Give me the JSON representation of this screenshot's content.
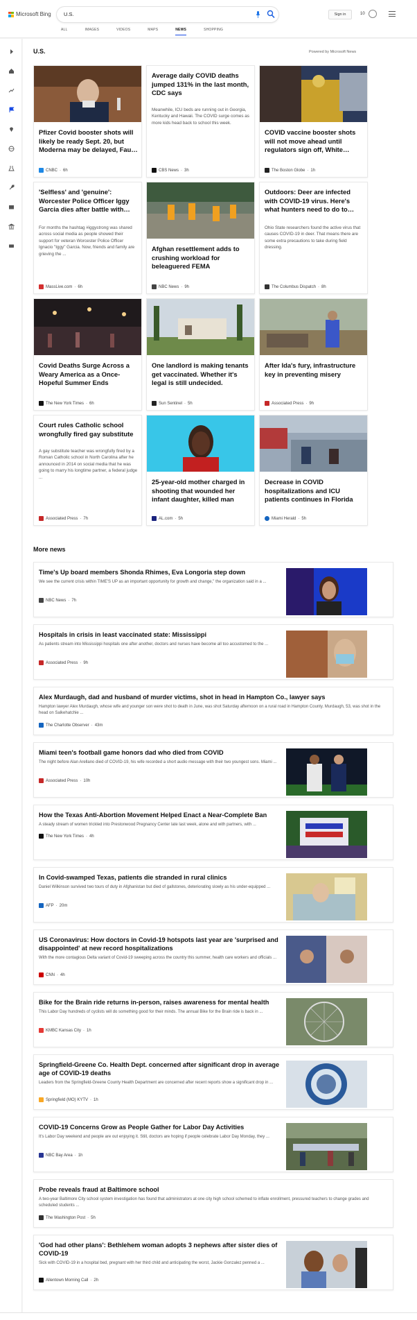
{
  "header": {
    "logo_text": "Microsoft Bing",
    "search_value": "U.S.",
    "signin_label": "Sign in",
    "points": "10",
    "tabs": [
      {
        "label": "ALL"
      },
      {
        "label": "IMAGES"
      },
      {
        "label": "VIDEOS"
      },
      {
        "label": "MAPS"
      },
      {
        "label": "NEWS",
        "active": true
      },
      {
        "label": "SHOPPING"
      }
    ]
  },
  "rail_icons": [
    "expand-icon",
    "home-icon",
    "trending-icon",
    "flag-icon",
    "location-icon",
    "world-icon",
    "science-icon",
    "rocket-icon",
    "entertainment-icon",
    "politics-icon",
    "money-icon"
  ],
  "main": {
    "section_title": "U.S.",
    "powered_by": "Powered by Microsoft News",
    "more_title": "More news"
  },
  "cards": [
    {
      "title": "Pfizer Covid booster shots will likely be ready Sept. 20, but Moderna may be delayed, Fau…",
      "snippet": "",
      "source": "CNBC",
      "time": "6h",
      "logo_color": "#1e88e5"
    },
    {
      "title": "Average daily COVID deaths jumped 131% in the last month, CDC says",
      "snippet": "Meanwhile, ICU beds are running out in Georgia, Kentucky and Hawaii. The COVID surge comes as more kids head back to school this week.",
      "source": "CBS News",
      "time": "3h",
      "logo_color": "#111111"
    },
    {
      "title": "COVID vaccine booster shots will not move ahead until regulators sign off, White…",
      "snippet": "",
      "source": "The Boston Globe",
      "time": "1h",
      "logo_color": "#222222"
    },
    {
      "title": "'Selfless' and 'genuine': Worcester Police Officer Iggy Garcia dies after battle with…",
      "snippet": "For months the hashtag #iggystrong was shared across social media as people showed their support for veteran Worcester Police Officer Ignacio \"Iggy\" Garcia. Now, friends and family are grieving the ...",
      "source": "MassLive.com",
      "time": "6h",
      "logo_color": "#d32f2f"
    },
    {
      "title": "Afghan resettlement adds to crushing workload for beleaguered FEMA",
      "snippet": "",
      "source": "NBC News",
      "time": "9h",
      "logo_color": "#444444"
    },
    {
      "title": "Outdoors: Deer are infected with COVID-19 virus. Here's what hunters need to do to…",
      "snippet": "Ohio State researchers found the active virus that causes COVID-19 in deer. That means there are some extra precautions to take during field dressing.",
      "source": "The Columbus Dispatch",
      "time": "8h",
      "logo_color": "#333333"
    },
    {
      "title": "Covid Deaths Surge Across a Weary America as a Once-Hopeful Summer Ends",
      "snippet": "",
      "source": "The New York Times",
      "time": "6h",
      "logo_color": "#111111"
    },
    {
      "title": "One landlord is making tenants get vaccinated. Whether it's legal is still undecided.",
      "snippet": "",
      "source": "Sun Sentinel",
      "time": "5h",
      "logo_color": "#222222"
    },
    {
      "title": "After Ida's fury, infrastructure key in preventing misery",
      "snippet": "",
      "source": "Associated Press",
      "time": "9h",
      "logo_color": "#c62828"
    },
    {
      "title": "Court rules Catholic school wrongfully fired gay substitute",
      "snippet": "A gay substitute teacher was wrongfully fired by a Roman Catholic school in North Carolina after he announced in 2014 on social media that he was going to marry his longtime partner, a federal judge ...",
      "source": "Associated Press",
      "time": "7h",
      "logo_color": "#c62828"
    },
    {
      "title": "25-year-old mother charged in shooting that wounded her infant daughter, killed man",
      "snippet": "",
      "source": "AL.com",
      "time": "5h",
      "logo_color": "#1a237e"
    },
    {
      "title": "Decrease in COVID hospitalizations and ICU patients continues in Florida",
      "snippet": "",
      "source": "Miami Herald",
      "time": "5h",
      "logo_color": "#1565c0"
    }
  ],
  "more_news": [
    {
      "title": "Time's Up board members Shonda Rhimes, Eva Longoria step down",
      "snippet": "We see the current crisis within TIME'S UP as an important opportunity for growth and change,\" the organization said in a ...",
      "source": "NBC News",
      "time": "7h",
      "logo_color": "#444444"
    },
    {
      "title": "Hospitals in crisis in least vaccinated state: Mississippi",
      "snippet": "As patients stream into Mississippi hospitals one after another, doctors and nurses have become all too accustomed to the ...",
      "source": "Associated Press",
      "time": "9h",
      "logo_color": "#c62828"
    },
    {
      "title": "Alex Murdaugh, dad and husband of murder victims, shot in head in Hampton Co., lawyer says",
      "snippet": "Hampton lawyer Alex Murdaugh, whose wife and younger son were shot to death in June, was shot Saturday afternoon on a rural road in Hampton County. Murdaugh, 53, was shot in the head on Salkehatchie ...",
      "source": "The Charlotte Observer",
      "time": "43m",
      "logo_color": "#1565c0"
    },
    {
      "title": "Miami teen's football game honors dad who died from COVID",
      "snippet": "The night before Alan Arellano died of COVID-19, his wife recorded a short audio message with their two youngest sons. Miami ...",
      "source": "Associated Press",
      "time": "10h",
      "logo_color": "#c62828"
    },
    {
      "title": "How the Texas Anti-Abortion Movement Helped Enact a Near-Complete Ban",
      "snippet": "A steady stream of women trickled into Prestonwood Pregnancy Center late last week, alone and with partners, with ...",
      "source": "The New York Times",
      "time": "4h",
      "logo_color": "#111111"
    },
    {
      "title": "In Covid-swamped Texas, patients die stranded in rural clinics",
      "snippet": "Daniel Wilkinson survived two tours of duty in Afghanistan but died of gallstones, deteriorating slowly as his under-equipped ...",
      "source": "AFP",
      "time": "20m",
      "logo_color": "#1565c0"
    },
    {
      "title": "US Coronavirus: How doctors in Covid-19 hotspots last year are 'surprised and disappointed' at new record hospitalizations",
      "snippet": "With the more contagious Delta variant of Covid-19 sweeping across the country this summer, health care workers and officials ...",
      "source": "CNN",
      "time": "4h",
      "logo_color": "#cc0000"
    },
    {
      "title": "Bike for the Brain ride returns in-person, raises awareness for mental health",
      "snippet": "This Labor Day hundreds of cyclists will do something good for their minds. The annual Bike for the Brain ride is back in ...",
      "source": "KMBC Kansas City",
      "time": "1h",
      "logo_color": "#e53935"
    },
    {
      "title": "Springfield-Greene Co. Health Dept. concerned after significant drop in average age of COVID-19 deaths",
      "snippet": "Leaders from the Springfield-Greene County Health Department are concerned after recent reports show a significant drop in ...",
      "source": "Springfield (MO) KYTV",
      "time": "1h",
      "logo_color": "#f9a825"
    },
    {
      "title": "COVID-19 Concerns Grow as People Gather for Labor Day Activities",
      "snippet": "It's Labor Day weekend and people are out enjoying it. Still, doctors are hoping if people celebrate Labor Day Monday, they ...",
      "source": "NBC Bay Area",
      "time": "1h",
      "logo_color": "#283593"
    },
    {
      "title": "Probe reveals fraud at Baltimore school",
      "snippet": "A two-year Baltimore City school system investigation has found that administrators at one city high school schemed to inflate enrollment, pressured teachers to change grades and scheduled students ...",
      "source": "The Washington Post",
      "time": "5h",
      "logo_color": "#333333"
    },
    {
      "title": "'God had other plans': Bethlehem woman adopts 3 nephews after sister dies of COVID-19",
      "snippet": "Sick with COVID-19 in a hospital bed, pregnant with her third child and anticipating the worst, Jackie Gonzalez penned a ...",
      "source": "Allentown Morning Call",
      "time": "2h",
      "logo_color": "#111111"
    }
  ]
}
